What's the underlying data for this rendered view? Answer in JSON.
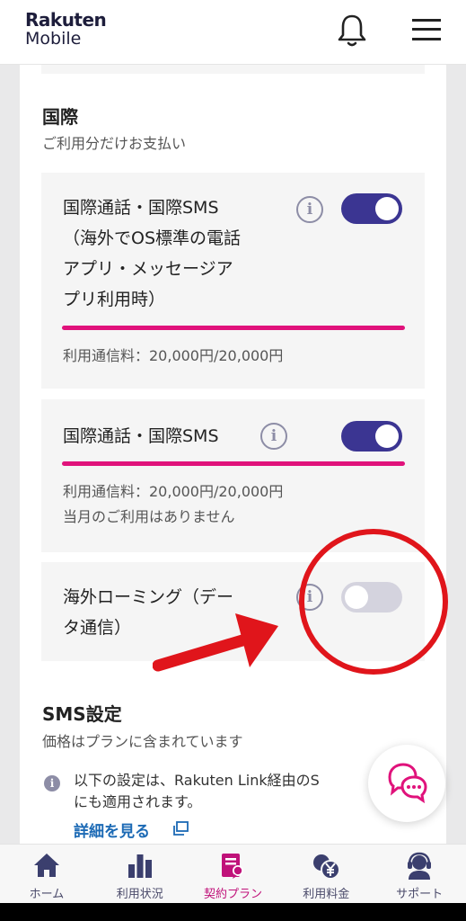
{
  "header": {
    "brand_line1": "Rakuten",
    "brand_line2": "Mobile",
    "bell_icon": "bell-icon",
    "menu_icon": "hamburger-menu-icon"
  },
  "international": {
    "title": "国際",
    "subtitle": "ご利用分だけお支払い",
    "options": [
      {
        "label_lines": [
          "国際通話・国際SMS",
          "（海外でOS標準の電話",
          "アプリ・メッセージア",
          "プリ利用時）"
        ],
        "usage": "利用通信料：20,000円/20,000円",
        "enabled": true,
        "usage_fraction": 1.0
      },
      {
        "label_lines": [
          "国際通話・国際SMS"
        ],
        "usage": "利用通信料：20,000円/20,000円",
        "note": "当月のご利用はありません",
        "enabled": true,
        "usage_fraction": 1.0
      },
      {
        "label_lines": [
          "海外ローミング（デー",
          "タ通信）"
        ],
        "enabled": false
      }
    ]
  },
  "sms": {
    "title": "SMS設定",
    "subtitle": "価格はプランに含まれています",
    "note_line1": "以下の設定は、Rakuten Link経由のS",
    "note_line2": "にも適用されます。",
    "link_label": "詳細を見る"
  },
  "tabs": [
    {
      "label": "ホーム",
      "icon": "home-icon",
      "active": false
    },
    {
      "label": "利用状況",
      "icon": "bar-chart-icon",
      "active": false
    },
    {
      "label": "契約プラン",
      "icon": "contract-icon",
      "active": true
    },
    {
      "label": "利用料金",
      "icon": "yen-coin-icon",
      "active": false
    },
    {
      "label": "サポート",
      "icon": "support-icon",
      "active": false
    }
  ],
  "colors": {
    "accent_magenta": "#e0127b",
    "toggle_on": "#3b3592",
    "toggle_off": "#d4d3de",
    "link_blue": "#1c6ab5",
    "annotation_red": "#e0151b"
  }
}
